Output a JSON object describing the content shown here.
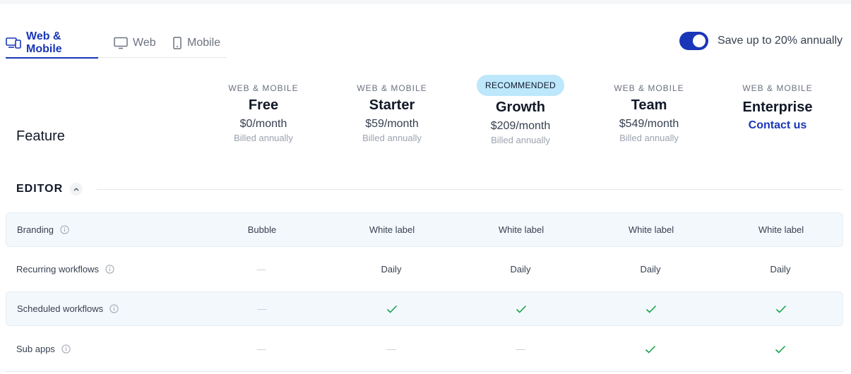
{
  "tabs": [
    {
      "label": "Web & Mobile",
      "icon": "devices-icon",
      "active": true
    },
    {
      "label": "Web",
      "icon": "monitor-icon",
      "active": false
    },
    {
      "label": "Mobile",
      "icon": "phone-icon",
      "active": false
    }
  ],
  "toggle": {
    "label": "Save up to 20% annually",
    "on": true
  },
  "feature_header": "Feature",
  "plans": [
    {
      "eyebrow": "WEB & MOBILE",
      "name": "Free",
      "price": "$0/month",
      "billed": "Billed annually"
    },
    {
      "eyebrow": "WEB & MOBILE",
      "name": "Starter",
      "price": "$59/month",
      "billed": "Billed annually"
    },
    {
      "badge": "RECOMMENDED",
      "name": "Growth",
      "price": "$209/month",
      "billed": "Billed annually"
    },
    {
      "eyebrow": "WEB & MOBILE",
      "name": "Team",
      "price": "$549/month",
      "billed": "Billed annually"
    },
    {
      "eyebrow": "WEB & MOBILE",
      "name": "Enterprise",
      "contact": "Contact us"
    }
  ],
  "section": {
    "label": "EDITOR",
    "expanded": true
  },
  "rows": [
    {
      "feature": "Branding",
      "values": [
        "Bubble",
        "White label",
        "White label",
        "White label",
        "White label"
      ]
    },
    {
      "feature": "Recurring workflows",
      "values": [
        "—",
        "Daily",
        "Daily",
        "Daily",
        "Daily"
      ]
    },
    {
      "feature": "Scheduled workflows",
      "values": [
        "—",
        "✓",
        "✓",
        "✓",
        "✓"
      ]
    },
    {
      "feature": "Sub apps",
      "values": [
        "—",
        "—",
        "—",
        "✓",
        "✓"
      ]
    }
  ],
  "colors": {
    "accent": "#1a36b8",
    "check": "#16a34a",
    "badge": "#bde7fb",
    "row_shade": "#f3f8fc"
  }
}
